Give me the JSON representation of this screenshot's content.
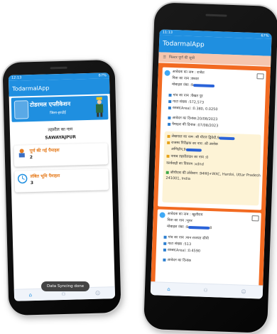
{
  "app_name": "TodarmalApp",
  "status_time_left": "12:13",
  "status_time_right": "11:13",
  "status_battery": "67%",
  "phone1": {
    "banner_title": "टोडरमल एप्लीकेशन",
    "banner_subtitle": "जिला-हरदोई",
    "tehsil_label": "तहसील का नाम",
    "tehsil_value": "SAWAYAJPUR",
    "cards": [
      {
        "title": "पूर्ण की गई पैमाइश",
        "value": "2"
      },
      {
        "title": "लंबित भूमि पैमाइश",
        "value": "3"
      }
    ]
  },
  "phone2": {
    "filter_label": "फिल्टर पूर्ण की सूची",
    "record1": {
      "applicant": "आवेदक का नाम : राजेश",
      "father": "पिता का नाम :छावत",
      "mobile": "मोबाइल नंबर :9",
      "village": "गांव का नाम :चैखत पुर",
      "gata": "गाटा संख्या :572,573",
      "area": "रकबा(Area) :0.380, 0.0250",
      "applied_date": "आवेदन का दिनांक:20/08/2023",
      "measure_date": "पैमाइश की दिनांक :07/08/2023",
      "lekhpal": "लेखपाल का नाम :श्री धीरज द्विवेदी,9",
      "rajaswa": "राजस्व निरीक्षक का नाम :श्री अशोक",
      "rajaswa2": "अग्निहोत्र,9",
      "tehsildar": "नायब तहसीलदार का नाम :0",
      "action": "कार्यवाही का विवरण :xdnd",
      "location": "जीपीएस की लोकेशन :94WJ+WXC, Hardoi, Uttar Pradesh 241001, India"
    },
    "record2": {
      "applicant": "आवेदक का नाम : खुशीराम",
      "father": "पिता का नाम :भूपर",
      "mobile": "मोबाइल नंबर :9",
      "mobile_suffix": "8",
      "village": "गांव का नाम :मान राजपत सीपी",
      "gata": "गाटा संख्या :513",
      "area": "रकबा(Area) :0.4590",
      "applied_date": "आवेदन का दिनांक"
    },
    "toast": "Data Syncing done"
  },
  "colors": {
    "primary": "#1f8fe0",
    "orange": "#f26a21",
    "card_title": "#e67e22"
  }
}
